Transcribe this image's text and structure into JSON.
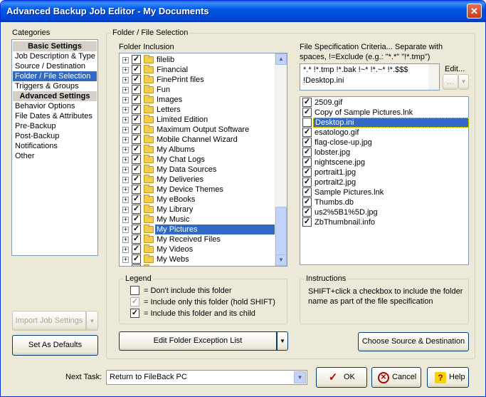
{
  "window": {
    "title": "Advanced Backup Job Editor - My Documents",
    "close_glyph": "✕"
  },
  "categories": {
    "label": "Categories",
    "items": [
      {
        "label": "Basic Settings",
        "kind": "header"
      },
      {
        "label": "Job Description & Type",
        "kind": "item"
      },
      {
        "label": "Source / Destination",
        "kind": "item"
      },
      {
        "label": "Folder / File Selection",
        "kind": "selected"
      },
      {
        "label": "Triggers & Groups",
        "kind": "item"
      },
      {
        "label": "Advanced Settings",
        "kind": "header"
      },
      {
        "label": "Behavior Options",
        "kind": "item"
      },
      {
        "label": "File Dates & Attributes",
        "kind": "item"
      },
      {
        "label": "Pre-Backup",
        "kind": "item"
      },
      {
        "label": "Post-Backup",
        "kind": "item"
      },
      {
        "label": "Notifications",
        "kind": "item"
      },
      {
        "label": "Other",
        "kind": "item"
      }
    ]
  },
  "left_buttons": {
    "import": "Import Job Settings",
    "defaults": "Set As Defaults"
  },
  "folder_section": {
    "group_title": "Folder / File Selection",
    "inclusion_label": "Folder Inclusion",
    "folders": [
      {
        "name": "filelib",
        "selected": false
      },
      {
        "name": "Financial",
        "selected": false
      },
      {
        "name": "FinePrint files",
        "selected": false
      },
      {
        "name": "Fun",
        "selected": false
      },
      {
        "name": "Images",
        "selected": false
      },
      {
        "name": "Letters",
        "selected": false
      },
      {
        "name": "Limited Edition",
        "selected": false
      },
      {
        "name": "Maximum Output Software",
        "selected": false
      },
      {
        "name": "Mobile Channel Wizard",
        "selected": false
      },
      {
        "name": "My Albums",
        "selected": false
      },
      {
        "name": "My Chat Logs",
        "selected": false
      },
      {
        "name": "My Data Sources",
        "selected": false
      },
      {
        "name": "My Deliveries",
        "selected": false
      },
      {
        "name": "My Device Themes",
        "selected": false
      },
      {
        "name": "My eBooks",
        "selected": false
      },
      {
        "name": "My Library",
        "selected": false
      },
      {
        "name": "My Music",
        "selected": false
      },
      {
        "name": "My Pictures",
        "selected": true
      },
      {
        "name": "My Received Files",
        "selected": false
      },
      {
        "name": "My Videos",
        "selected": false
      },
      {
        "name": "My Webs",
        "selected": false
      },
      {
        "name": "",
        "selected": false
      }
    ],
    "spec_label_1": "File Specification Criteria...  Separate with",
    "spec_label_2": "spaces, !=Exclude (e.g.: \"*.*\" \"!*.tmp\")",
    "spec_line_1": "*.* !*.tmp !*.bak !~* !*.~* !*.$$$",
    "spec_line_2": "!Desktop.ini",
    "edit_label": "Edit...",
    "files": [
      {
        "name": "2509.gif",
        "checked": true,
        "selected": false
      },
      {
        "name": "Copy of Sample Pictures.lnk",
        "checked": true,
        "selected": false
      },
      {
        "name": "Desktop.ini",
        "checked": false,
        "selected": true
      },
      {
        "name": "esatologo.gif",
        "checked": true,
        "selected": false
      },
      {
        "name": "flag-close-up.jpg",
        "checked": true,
        "selected": false
      },
      {
        "name": "lobster.jpg",
        "checked": true,
        "selected": false
      },
      {
        "name": "nightscene.jpg",
        "checked": true,
        "selected": false
      },
      {
        "name": "portrait1.jpg",
        "checked": true,
        "selected": false
      },
      {
        "name": "portrait2.jpg",
        "checked": true,
        "selected": false
      },
      {
        "name": "Sample Pictures.lnk",
        "checked": true,
        "selected": false
      },
      {
        "name": "Thumbs.db",
        "checked": true,
        "selected": false
      },
      {
        "name": "us2%5B1%5D.jpg",
        "checked": true,
        "selected": false
      },
      {
        "name": "ZbThumbnail.info",
        "checked": true,
        "selected": false
      }
    ],
    "legend": {
      "title": "Legend",
      "items": [
        {
          "text": "= Don't include this folder",
          "state": "unchecked"
        },
        {
          "text": "= Include only this folder (hold SHIFT)",
          "state": "gray"
        },
        {
          "text": "= Include this folder and its child",
          "state": "checked"
        }
      ]
    },
    "instructions": {
      "title": "Instructions",
      "line_1": "SHIFT+click a checkbox to include the folder",
      "line_2": "name as part of the file specification"
    },
    "exception_button": "Edit Folder Exception List",
    "choose_button": "Choose Source & Destination"
  },
  "bottom": {
    "next_task_label": "Next Task:",
    "next_task_value": "Return to FileBack PC",
    "ok": "OK",
    "cancel": "Cancel",
    "help": "Help"
  },
  "glyphs": {
    "check": "✓",
    "plus": "+",
    "down": "▼",
    "up": "▲",
    "help": "?"
  },
  "colors": {
    "selection": "#316ac5",
    "title_bar": "#0058e6",
    "ok_icon": "#c00000"
  }
}
